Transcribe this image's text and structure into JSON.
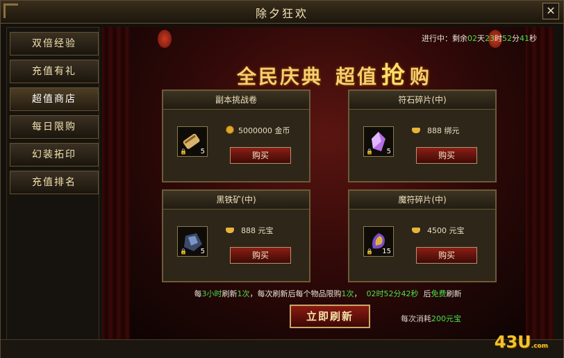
{
  "window": {
    "title": "除夕狂欢",
    "close_glyph": "✕"
  },
  "sidebar": {
    "items": [
      {
        "label": "双倍经验"
      },
      {
        "label": "充值有礼"
      },
      {
        "label": "超值商店"
      },
      {
        "label": "每日限购"
      },
      {
        "label": "幻装拓印"
      },
      {
        "label": "充值排名"
      }
    ],
    "active_index": 2
  },
  "status": {
    "prefix": "进行中：剩余",
    "days": "02",
    "days_unit": "天",
    "hours": "23",
    "hours_unit": "时",
    "minutes": "52",
    "minutes_unit": "分",
    "seconds": "41",
    "seconds_unit": "秒"
  },
  "banner": {
    "left": "全民庆典",
    "right_a": "超值",
    "right_big": "抢",
    "right_b": "购"
  },
  "items": [
    {
      "name": "副本挑战卷",
      "icon": "scroll-icon",
      "qty": "5",
      "price": "5000000",
      "currency": "金币",
      "currency_icon": "gold-coin-icon",
      "buy": "购买"
    },
    {
      "name": "符石碎片(中)",
      "icon": "rune-shard-icon",
      "qty": "5",
      "price": "888",
      "currency": "绑元",
      "currency_icon": "bound-ingot-icon",
      "buy": "购买"
    },
    {
      "name": "黑铁矿(中)",
      "icon": "iron-ore-icon",
      "qty": "5",
      "price": "888",
      "currency": "元宝",
      "currency_icon": "ingot-icon",
      "buy": "购买"
    },
    {
      "name": "魔符碎片(中)",
      "icon": "magic-rune-icon",
      "qty": "15",
      "price": "4500",
      "currency": "元宝",
      "currency_icon": "ingot-icon",
      "buy": "购买"
    }
  ],
  "refresh": {
    "p1": "每",
    "hours": "3小时",
    "p2": "刷新",
    "times": "1次",
    "p3": "，每次刷新后每个物品限购",
    "limit": "1次",
    "p4": "，",
    "countdown": "02时52分42秒",
    "p5": "后",
    "free": "免费",
    "p6": "刷新",
    "button": "立即刷新",
    "cost_prefix": "每次消耗",
    "cost": "200元宝"
  },
  "branding": {
    "logo": "43U",
    "domain": ".com"
  },
  "colors": {
    "accent": "#f4d070",
    "highlight": "#48e04e",
    "button": "#8b1e16"
  }
}
